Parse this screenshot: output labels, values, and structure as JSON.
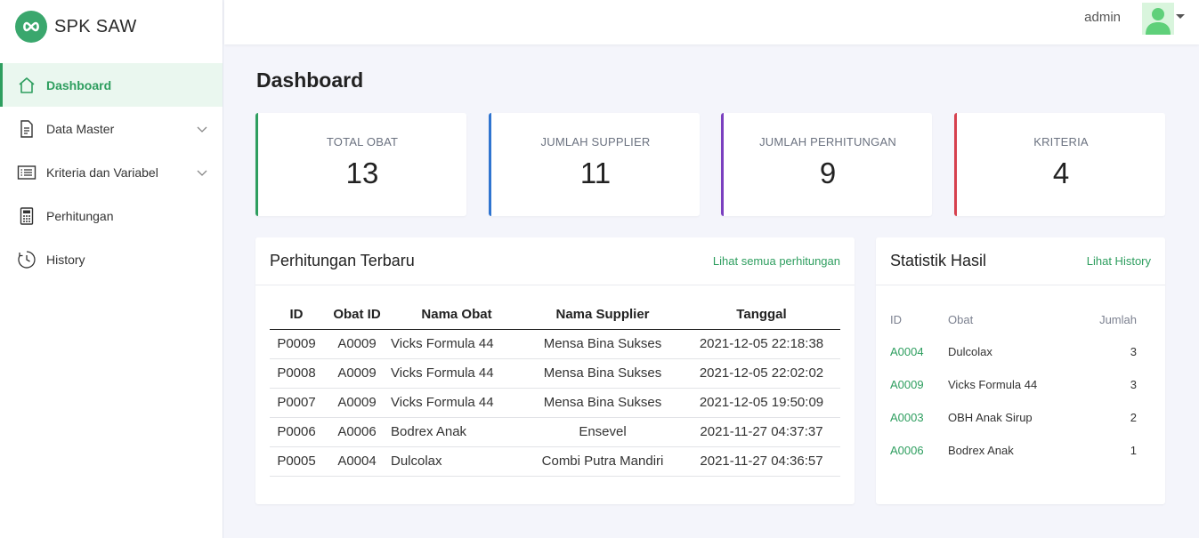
{
  "app": {
    "name": "SPK SAW"
  },
  "sidebar": {
    "items": [
      {
        "label": "Dashboard",
        "icon": "home-icon",
        "active": true
      },
      {
        "label": "Data Master",
        "icon": "document-icon",
        "expandable": true
      },
      {
        "label": "Kriteria dan Variabel",
        "icon": "list-icon",
        "expandable": true
      },
      {
        "label": "Perhitungan",
        "icon": "calculator-icon"
      },
      {
        "label": "History",
        "icon": "history-icon"
      }
    ]
  },
  "topbar": {
    "user": "admin",
    "avatar_icon": "user-avatar-icon"
  },
  "page": {
    "title": "Dashboard"
  },
  "stats": [
    {
      "label": "TOTAL OBAT",
      "value": "13",
      "color": "#2e9e5f"
    },
    {
      "label": "JUMLAH SUPPLIER",
      "value": "11",
      "color": "#2f74d0"
    },
    {
      "label": "JUMLAH PERHITUNGAN",
      "value": "9",
      "color": "#7a3fbf"
    },
    {
      "label": "KRITERIA",
      "value": "4",
      "color": "#d6404e"
    }
  ],
  "recent": {
    "title": "Perhitungan Terbaru",
    "link": "Lihat semua perhitungan",
    "columns": [
      "ID",
      "Obat ID",
      "Nama Obat",
      "Nama Supplier",
      "Tanggal"
    ],
    "rows": [
      [
        "P0009",
        "A0009",
        "Vicks Formula 44",
        "Mensa Bina Sukses",
        "2021-12-05 22:18:38"
      ],
      [
        "P0008",
        "A0009",
        "Vicks Formula 44",
        "Mensa Bina Sukses",
        "2021-12-05 22:02:02"
      ],
      [
        "P0007",
        "A0009",
        "Vicks Formula 44",
        "Mensa Bina Sukses",
        "2021-12-05 19:50:09"
      ],
      [
        "P0006",
        "A0006",
        "Bodrex Anak",
        "Ensevel",
        "2021-11-27 04:37:37"
      ],
      [
        "P0005",
        "A0004",
        "Dulcolax",
        "Combi Putra Mandiri",
        "2021-11-27 04:36:57"
      ]
    ]
  },
  "statistik": {
    "title": "Statistik Hasil",
    "link": "Lihat History",
    "columns": [
      "ID",
      "Obat",
      "Jumlah"
    ],
    "rows": [
      [
        "A0004",
        "Dulcolax",
        "3"
      ],
      [
        "A0009",
        "Vicks Formula 44",
        "3"
      ],
      [
        "A0003",
        "OBH Anak Sirup",
        "2"
      ],
      [
        "A0006",
        "Bodrex Anak",
        "1"
      ]
    ]
  }
}
